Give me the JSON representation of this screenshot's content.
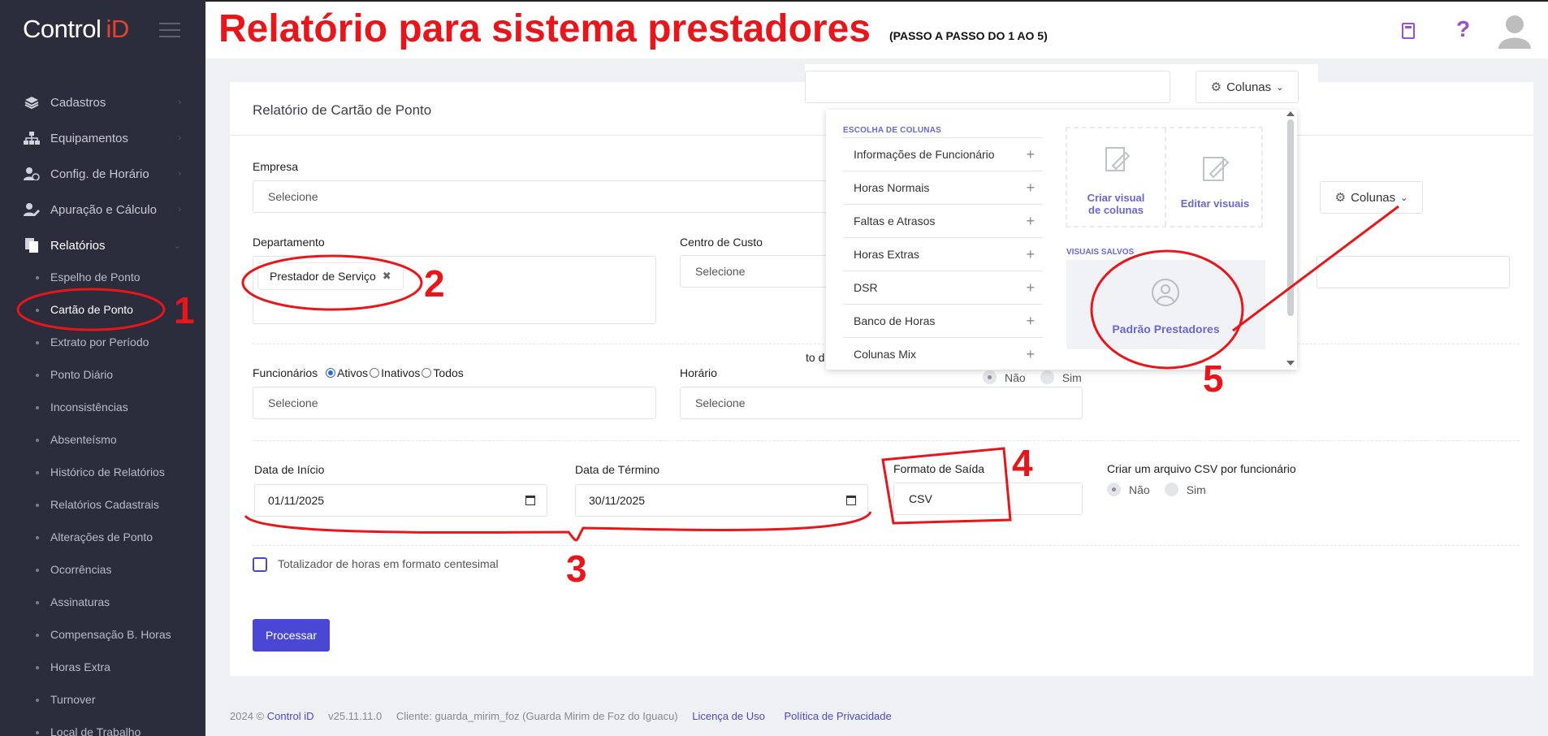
{
  "brand": {
    "name": "Control",
    "id_part": "iD"
  },
  "headline": {
    "title": "Relatório para sistema prestadores",
    "subtitle": "(PASSO A PASSO DO 1 AO 5)"
  },
  "sidebar": {
    "items": [
      {
        "label": "Cadastros",
        "icon": "layers-icon"
      },
      {
        "label": "Equipamentos",
        "icon": "sitemap-icon"
      },
      {
        "label": "Config. de Horário",
        "icon": "user-clock-icon"
      },
      {
        "label": "Apuração e Cálculo",
        "icon": "user-edit-icon"
      },
      {
        "label": "Relatórios",
        "icon": "report-icon"
      }
    ],
    "sub_items": [
      "Espelho de Ponto",
      "Cartão de Ponto",
      "Extrato por Período",
      "Ponto Diário",
      "Inconsistências",
      "Absenteísmo",
      "Histórico de Relatórios",
      "Relatórios Cadastrais",
      "Alterações de Ponto",
      "Ocorrências",
      "Assinaturas",
      "Compensação B. Horas",
      "Horas Extra",
      "Turnover",
      "Local de Trabalho"
    ],
    "active_sub": "Cartão de Ponto"
  },
  "form": {
    "title": "Relatório de Cartão de Ponto",
    "empresa": {
      "label": "Empresa",
      "placeholder": "Selecione"
    },
    "departamento": {
      "label": "Departamento",
      "chip": "Prestador de Serviço",
      "chip_x": "✖"
    },
    "centro": {
      "label": "Centro de Custo",
      "placeholder": "Selecione"
    },
    "funcionarios": {
      "label": "Funcionários",
      "opt1": "Ativos",
      "opt2": "Inativos",
      "opt3": "Todos",
      "placeholder": "Selecione"
    },
    "horario": {
      "label": "Horário",
      "placeholder": "Selecione"
    },
    "hidden_label_fragment": "to d",
    "hidden_radio": {
      "no": "Não",
      "yes": "Sim"
    },
    "data_inicio": {
      "label": "Data de Início",
      "value": "01/11/2025"
    },
    "data_termino": {
      "label": "Data de Término",
      "value": "30/11/2025"
    },
    "formato": {
      "label": "Formato de Saída",
      "value": "CSV"
    },
    "csv_func": {
      "label": "Criar um arquivo CSV por funcionário",
      "no": "Não",
      "yes": "Sim"
    },
    "centesimal": "Totalizador de horas em formato centesimal",
    "process": "Processar",
    "colunas": "Colunas"
  },
  "popover": {
    "colunas": "Colunas",
    "section": "ESCOLHA DE COLUNAS",
    "columns": [
      "Informações de Funcionário",
      "Horas Normais",
      "Faltas e Atrasos",
      "Horas Extras",
      "DSR",
      "Banco de Horas",
      "Colunas Mix"
    ],
    "plus": "+",
    "create_tile": {
      "line1": "Criar visual",
      "line2": "de colunas"
    },
    "edit_tile": "Editar visuais",
    "saved_header": "VISUAIS SALVOS",
    "saved_item": "Padrão Prestadores"
  },
  "annotations": [
    "1",
    "2",
    "3",
    "4",
    "5"
  ],
  "footer": {
    "copy": "2024 ©",
    "brand": "Control iD",
    "version": "v25.11.11.0",
    "client": "Cliente: guarda_mirim_foz (Guarda Mirim de Foz do Iguacu)",
    "license": "Licença de Uso",
    "privacy": "Política de Privacidade"
  },
  "colors": {
    "sidebar": "#2b2d3d",
    "accent": "#4a47d4",
    "annotation": "#e8151a",
    "popover_accent": "#6a67cf"
  }
}
